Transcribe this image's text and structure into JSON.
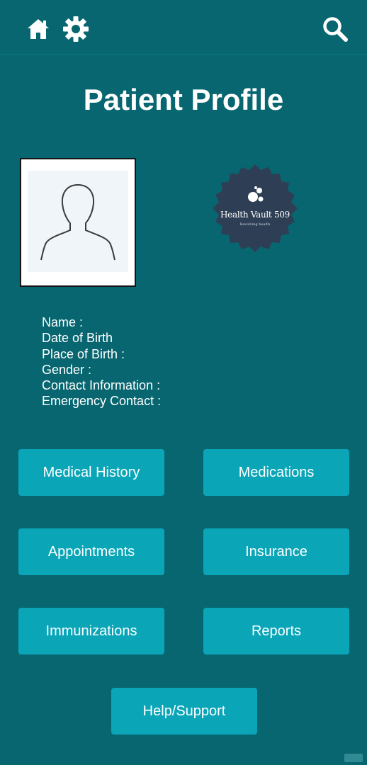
{
  "header": {
    "icons": [
      "home-icon",
      "gear-icon",
      "search-icon"
    ]
  },
  "page": {
    "title": "Patient Profile"
  },
  "logo": {
    "name": "Health Vault 509",
    "tagline": "Revolving health"
  },
  "profile_fields": {
    "name": "Name :",
    "dob": "Date of Birth",
    "pob": "Place of Birth :",
    "gender": "Gender :",
    "contact": "Contact Information :",
    "emergency": "Emergency Contact :"
  },
  "menu": {
    "medical_history": "Medical History",
    "medications": "Medications",
    "appointments": "Appointments",
    "insurance": "Insurance",
    "immunizations": "Immunizations",
    "reports": "Reports",
    "help": "Help/Support"
  },
  "colors": {
    "background": "#076670",
    "button": "#0aa6b8",
    "logo_badge": "#2e3f55"
  }
}
